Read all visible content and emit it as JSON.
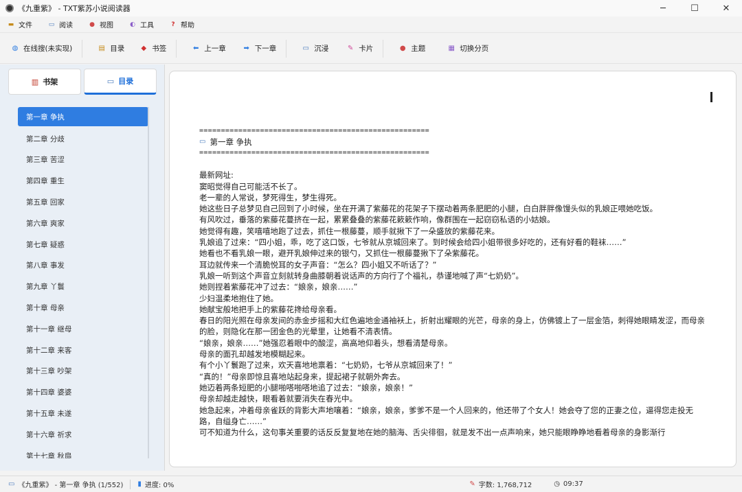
{
  "window": {
    "title": "《九重紫》 - TXT紫苏小说阅读器",
    "minimize": "─",
    "maximize": "☐",
    "close": "✕"
  },
  "menu": [
    {
      "icon": "▬",
      "label": "文件"
    },
    {
      "icon": "▭",
      "label": "阅读"
    },
    {
      "icon": "●",
      "label": "视图"
    },
    {
      "icon": "◐",
      "label": "工具"
    },
    {
      "icon": "?",
      "label": "帮助"
    }
  ],
  "toolbar": {
    "search": "在线搜(未实现)",
    "toc": "目录",
    "bookmark": "书签",
    "prev": "上一章",
    "next": "下一章",
    "immersive": "沉浸",
    "card": "卡片",
    "theme": "主题",
    "paging": "切换分页"
  },
  "sidebar": {
    "tab_shelf": "书架",
    "tab_toc": "目录",
    "chapters": [
      "第一章 争执",
      "第二章 分歧",
      "第三章 苦涩",
      "第四章 重生",
      "第五章 回家",
      "第六章 爽家",
      "第七章 疑惑",
      "第八章 事发",
      "第九章 丫鬟",
      "第十章 母亲",
      "第十一章 继母",
      "第十二章 来客",
      "第十三章 吵架",
      "第十四章 婆婆",
      "第十五章 未遂",
      "第十六章 祈求",
      "第十七章 秋扇"
    ]
  },
  "reader": {
    "rule": "=====================================================",
    "chapter_title": "第一章 争执",
    "paragraphs": [
      "最新网址:",
      "窦昭觉得自己可能活不长了。",
      "老一辈的人常说，梦死得生，梦生得死。",
      "她这些日子总梦见自己回到了小时候，坐在开满了紫藤花的花架子下摆动着两条肥肥的小腿，白白胖胖像馒头似的乳娘正喂她吃饭。",
      "有风吹过，垂落的紫藤花蔓挤在一起，累累叠叠的紫藤花簌簌作响，像群围在一起窃窃私语的小姑娘。",
      "她觉得有趣，笑嘻嘻地跑了过去，抓住一根藤蔓，顺手就揪下了一朵盛放的紫藤花来。",
      "乳娘追了过来：“四小姐，乖，吃了这口饭，七爷就从京城回来了。到时候会给四小姐带很多好吃的，还有好看的鞋袜……”",
      "她看也不看乳娘一眼，避开乳娘伸过来的银勺，又抓住一根藤蔓揪下了朵紫藤花。",
      "耳边就传来一个清脆悦耳的女子声音：“怎么？四小姐又不听话了？”",
      "乳娘一听到这个声音立刻就转身曲膝朝着说话声的方向行了个福礼，恭谨地喊了声“七奶奶”。",
      "她则捏着紫藤花冲了过去：“娘亲，娘亲……”",
      "少妇温柔地抱住了她。",
      "她献宝般地把手上的紫藤花搀给母亲看。",
      "春日的阳光照在母亲发间的赤金步摇和大红色遍地金通袖袄上，折射出耀眼的光芒，母亲的身上，仿佛镀上了一层金箔，刺得她眼睛发涩，而母亲的脸，则隐化在那一团金色的光晕里，让她看不清表情。",
      "“娘亲，娘亲……”她强忍着眼中的酸涩，高高地仰着头，想看清楚母亲。",
      "母亲的面孔却越发地模糊起来。",
      "有个小丫鬟跑了过来，欢天喜地地禀着：“七奶奶，七爷从京城回来了！”",
      "“真的！”母亲即惊且喜地站起身来，提起裙子就朝外奔去。",
      "她迈着两条短肥的小腿啪嗒啪嗒地追了过去：“娘亲，娘亲！”",
      "母亲却越走越快，眼看着就要消失在春光中。",
      "她急起来，冲着母亲雀跃的背影大声地嚷着：“娘亲，娘亲，爹爹不是一个人回来的，他还带了个女人！她会夺了您的正妻之位，逼得您走投无路，自缢身亡……”",
      "可不知道为什么，这句事关重要的话反反复复地在她的脑海、舌尖徘徊，就是发不出一点声响来，她只能眼睁睁地看着母亲的身影渐行"
    ]
  },
  "status": {
    "book": "《九重紫》 - 第一章 争执 (1/552)",
    "progress": "进度: 0%",
    "words": "字数: 1,768,712",
    "time": "09:37"
  }
}
